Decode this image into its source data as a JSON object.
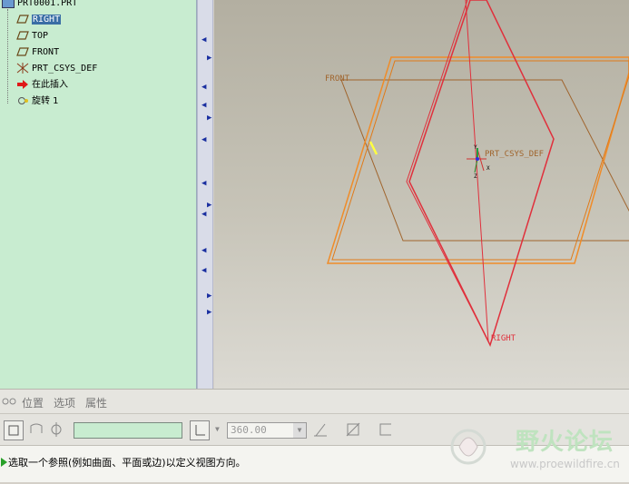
{
  "model_tree": {
    "root_label": "PRT0001.PRT",
    "items": [
      {
        "label": "RIGHT",
        "icon": "datum-plane-icon",
        "selected": true
      },
      {
        "label": "TOP",
        "icon": "datum-plane-icon",
        "selected": false
      },
      {
        "label": "FRONT",
        "icon": "datum-plane-icon",
        "selected": false
      },
      {
        "label": "PRT_CSYS_DEF",
        "icon": "coordinate-system-icon",
        "selected": false
      },
      {
        "label": "在此插入",
        "icon": "insert-here-arrow-icon",
        "selected": false
      },
      {
        "label": "旋转 1",
        "icon": "revolve-feature-icon",
        "selected": false
      }
    ]
  },
  "graphics": {
    "labels": {
      "front": "FRONT",
      "right": "RIGHT",
      "csys": "PRT_CSYS_DEF",
      "x_axis": "X",
      "y_axis": "Y",
      "z_axis": "Z"
    },
    "colors": {
      "right_plane": "#e0303c",
      "front_plane": "#a0642c",
      "top_plane": "#f08c28",
      "highlight": "#ffff40"
    }
  },
  "dashboard": {
    "tabs": [
      "位置",
      "选项",
      "属性"
    ],
    "angle_value": "360.00"
  },
  "status": {
    "message": "选取一个参照(例如曲面、平面或边)以定义视图方向。"
  },
  "watermark": {
    "title": "野火论坛",
    "url": "www.proewildfire.cn"
  }
}
